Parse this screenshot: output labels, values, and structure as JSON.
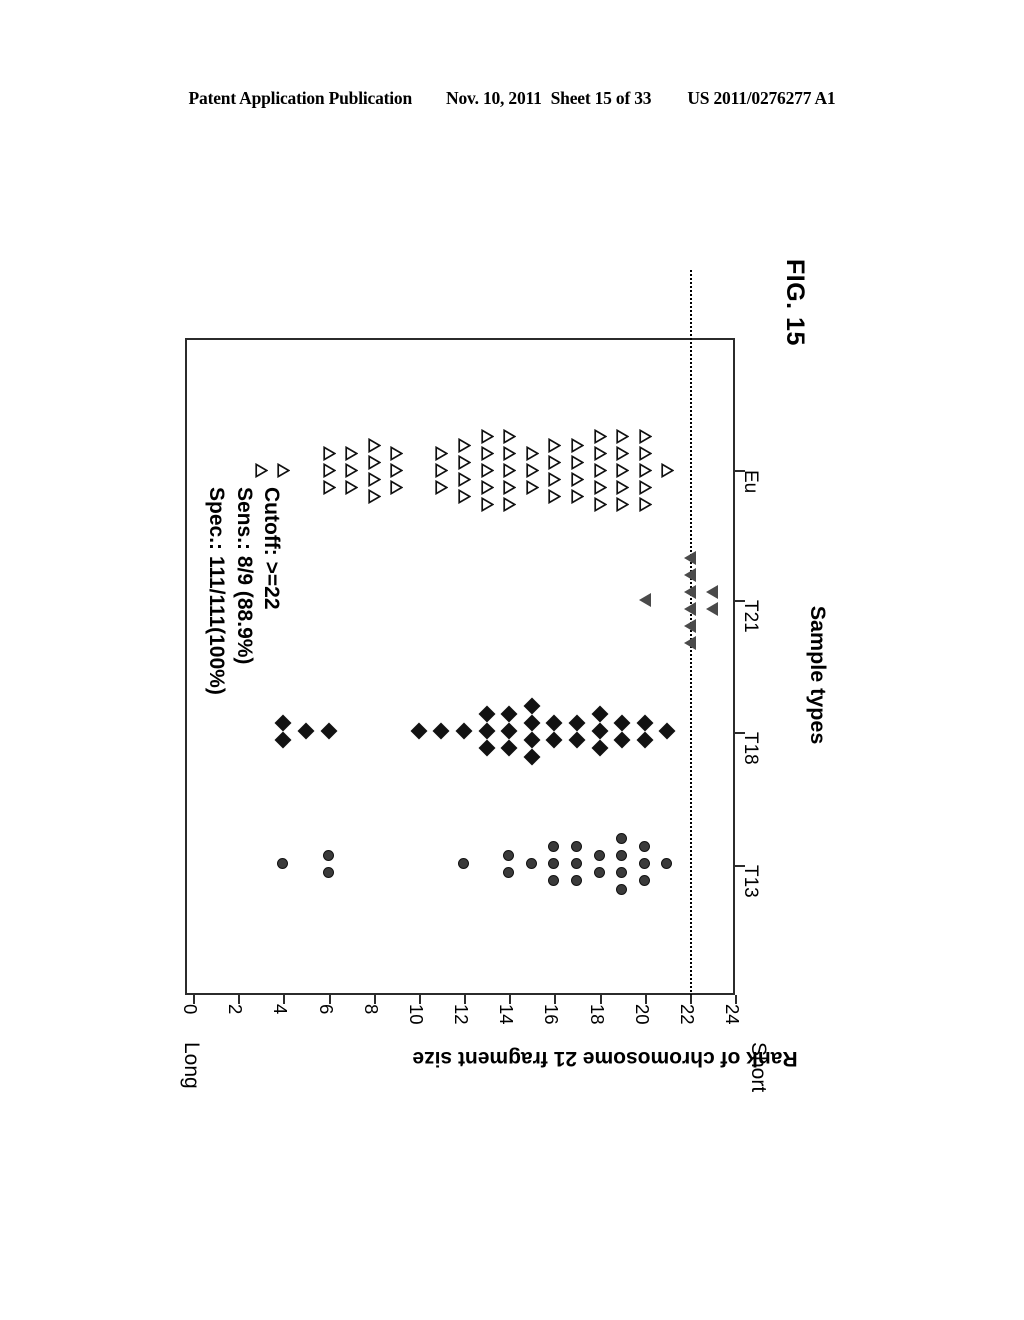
{
  "header": {
    "publication": "Patent Application Publication",
    "date": "Nov. 10, 2011",
    "sheet": "Sheet 15 of 33",
    "patent_number": "US 2011/0276277 A1"
  },
  "figure": {
    "label": "FIG. 15"
  },
  "annotation": {
    "line1": "Cutoff: >=22",
    "line2": "Sens.: 8/9 (88.9%)",
    "line3": "Spec.: 111/111(100%)"
  },
  "axes": {
    "rank_title": "Rank of chromosome 21 fragment size",
    "rank_low_label": "Long",
    "rank_high_label": "Short",
    "category_title": "Sample types",
    "rank_ticks": [
      "0",
      "2",
      "4",
      "6",
      "8",
      "10",
      "12",
      "14",
      "16",
      "18",
      "20",
      "22",
      "24"
    ],
    "categories": [
      "T13",
      "T18",
      "T21",
      "Eu"
    ]
  },
  "chart_data": {
    "type": "scatter",
    "title": "FIG. 15",
    "xlabel": "Rank of chromosome 21 fragment size",
    "ylabel": "Sample types",
    "xlim": [
      0,
      24
    ],
    "xticks": [
      0,
      2,
      4,
      6,
      8,
      10,
      12,
      14,
      16,
      18,
      20,
      22,
      24
    ],
    "categories": [
      "T13",
      "T18",
      "T21",
      "Eu"
    ],
    "grid": false,
    "legend": "none",
    "cutoff": {
      "value": 22,
      "label": "Cutoff: >=22",
      "style": "dotted"
    },
    "statistics": {
      "sensitivity": "8/9 (88.9%)",
      "sensitivity_value": 88.9,
      "specificity": "111/111(100%)",
      "specificity_value": 100.0
    },
    "annotations": [
      "Cutoff: >=22",
      "Sens.: 8/9 (88.9%)",
      "Spec.: 111/111(100%)"
    ],
    "endpoint_labels": {
      "low": "Long",
      "high": "Short"
    },
    "series": [
      {
        "name": "T13",
        "marker": "filled-circle",
        "color": "#3a3a3a",
        "ranks": [
          4,
          6,
          6,
          12,
          14,
          14,
          15,
          16,
          16,
          16,
          17,
          17,
          17,
          18,
          18,
          19,
          19,
          20,
          20,
          20,
          20,
          21,
          21,
          21,
          21
        ],
        "stacks": [
          {
            "rank": 4,
            "count": 1
          },
          {
            "rank": 6,
            "count": 2
          },
          {
            "rank": 12,
            "count": 1
          },
          {
            "rank": 14,
            "count": 2
          },
          {
            "rank": 15,
            "count": 1
          },
          {
            "rank": 16,
            "count": 3
          },
          {
            "rank": 17,
            "count": 3
          },
          {
            "rank": 18,
            "count": 2
          },
          {
            "rank": 19,
            "count": 4
          },
          {
            "rank": 20,
            "count": 3
          },
          {
            "rank": 21,
            "count": 1
          }
        ]
      },
      {
        "name": "T18",
        "marker": "filled-diamond",
        "color": "#121212",
        "stacks": [
          {
            "rank": 4,
            "count": 2
          },
          {
            "rank": 5,
            "count": 1
          },
          {
            "rank": 6,
            "count": 1
          },
          {
            "rank": 10,
            "count": 1
          },
          {
            "rank": 11,
            "count": 1
          },
          {
            "rank": 12,
            "count": 1
          },
          {
            "rank": 13,
            "count": 3
          },
          {
            "rank": 14,
            "count": 3
          },
          {
            "rank": 15,
            "count": 4
          },
          {
            "rank": 16,
            "count": 2
          },
          {
            "rank": 17,
            "count": 2
          },
          {
            "rank": 18,
            "count": 3
          },
          {
            "rank": 19,
            "count": 2
          },
          {
            "rank": 20,
            "count": 2
          },
          {
            "rank": 21,
            "count": 1
          }
        ]
      },
      {
        "name": "T21",
        "marker": "filled-triangle",
        "color": "#4a4a4a",
        "stacks": [
          {
            "rank": 20,
            "count": 1
          },
          {
            "rank": 22,
            "count": 6
          },
          {
            "rank": 23,
            "count": 2
          }
        ]
      },
      {
        "name": "Eu",
        "marker": "open-triangle",
        "color": "#ffffff",
        "stacks": [
          {
            "rank": 3,
            "count": 1
          },
          {
            "rank": 4,
            "count": 1
          },
          {
            "rank": 6,
            "count": 3
          },
          {
            "rank": 7,
            "count": 3
          },
          {
            "rank": 8,
            "count": 4
          },
          {
            "rank": 9,
            "count": 3
          },
          {
            "rank": 11,
            "count": 3
          },
          {
            "rank": 12,
            "count": 4
          },
          {
            "rank": 13,
            "count": 5
          },
          {
            "rank": 14,
            "count": 5
          },
          {
            "rank": 15,
            "count": 3
          },
          {
            "rank": 16,
            "count": 4
          },
          {
            "rank": 17,
            "count": 4
          },
          {
            "rank": 18,
            "count": 5
          },
          {
            "rank": 19,
            "count": 5
          },
          {
            "rank": 20,
            "count": 5
          },
          {
            "rank": 21,
            "count": 1
          }
        ]
      }
    ]
  }
}
